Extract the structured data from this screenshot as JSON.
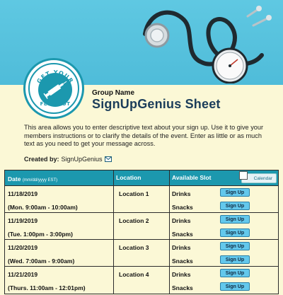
{
  "header": {
    "logo_text_top": "GET YOUR",
    "logo_text_bottom": "FLU SHOT",
    "group_name": "Group Name",
    "sheet_title": "SignUpGenius Sheet",
    "description": "This area allows you to enter descriptive text about your sign up. Use it to give your members instructions or to clarify the details of the event. Enter as little or as much text as you need to get your message across.",
    "created_by_label": "Created by:",
    "created_by_value": "SignUpGenius"
  },
  "table": {
    "col_date": "Date",
    "col_date_hint": "(mm/dd/yyyy EST)",
    "col_location": "Location",
    "col_slot": "Available Slot",
    "calendar_label": "Calendar",
    "signup_label": "Sign Up",
    "rows": [
      {
        "date": "11/18/2019",
        "time": "(Mon. 9:00am - 10:00am)",
        "location": "Location 1",
        "items": [
          "Drinks",
          "Snacks"
        ]
      },
      {
        "date": "11/19/2019",
        "time": "(Tue. 1:00pm - 3:00pm)",
        "location": "Location 2",
        "items": [
          "Drinks",
          "Snacks"
        ]
      },
      {
        "date": "11/20/2019",
        "time": "(Wed. 7:00am - 9:00am)",
        "location": "Location 3",
        "items": [
          "Drinks",
          "Snacks"
        ]
      },
      {
        "date": "11/21/2019",
        "time": "(Thurs. 11:00am - 12:01pm)",
        "location": "Location 4",
        "items": [
          "Drinks",
          "Snacks"
        ]
      }
    ]
  },
  "colors": {
    "banner": "#5fc8e2",
    "header_teal": "#1c98ae",
    "page_bg": "#fbf8d6",
    "title": "#1b3d5a",
    "button": "#63c8ec"
  },
  "icons": {
    "mail": "mail-icon",
    "calendar": "calendar-icon",
    "stethoscope": "stethoscope-icon",
    "syringe": "syringe-icon"
  }
}
